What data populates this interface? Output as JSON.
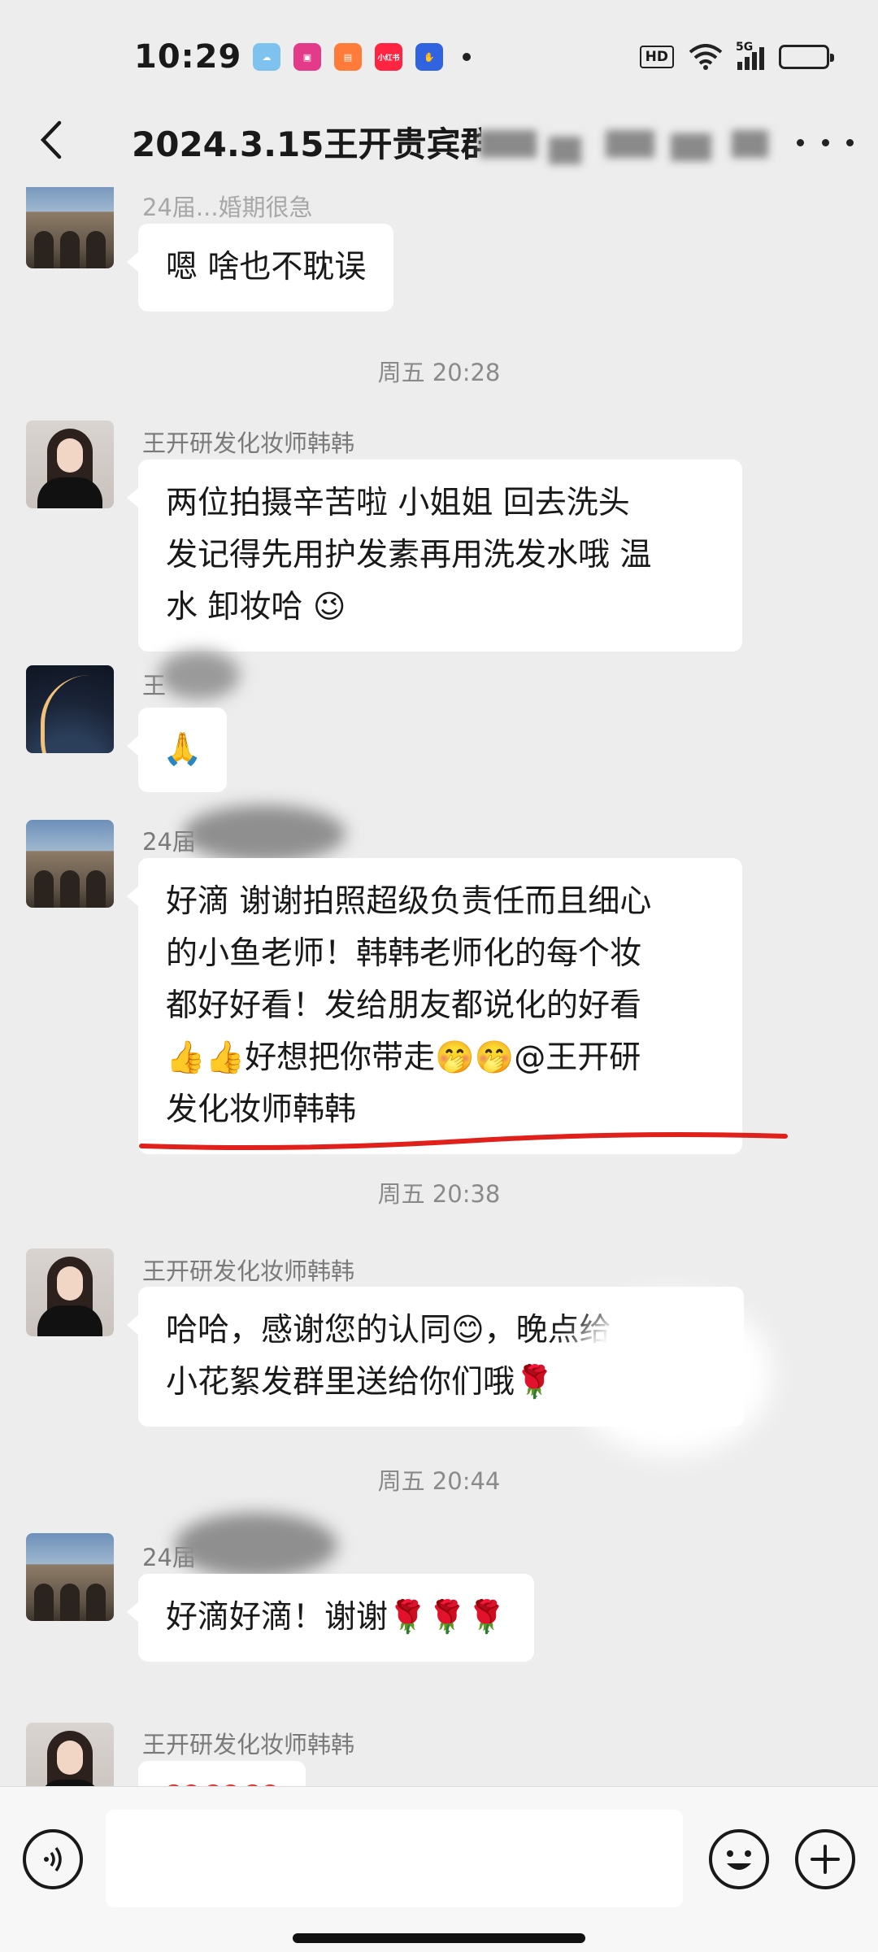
{
  "status_bar": {
    "time": "10:29",
    "app_icons": [
      {
        "icon": "weather-icon",
        "color": "#7ec3ef"
      },
      {
        "icon": "app-icon",
        "color": "#e33b8a"
      },
      {
        "icon": "book-icon",
        "color": "#ff7b3a"
      },
      {
        "icon": "xiaohongshu-icon",
        "label": "小红书",
        "color": "#ff2442"
      },
      {
        "icon": "baidu-icon",
        "color": "#2f63e0"
      }
    ],
    "hd_label": "HD",
    "network_label": "5G"
  },
  "nav": {
    "title": "2024.3.15王开贵宾群"
  },
  "messages": [
    {
      "type": "incoming",
      "sender": "24届...婚期很急",
      "avatar": "avatar-building",
      "text": "嗯 啥也不耽误"
    },
    {
      "type": "time",
      "text": "周五 20:28"
    },
    {
      "type": "incoming",
      "sender": "王开研发化妆师韩韩",
      "avatar": "avatar-portrait",
      "text": "两位拍摄辛苦啦 小姐姐 回去洗头\n发记得先用护发素再用洗发水哦 温\n水 卸妆哈 😉"
    },
    {
      "type": "incoming",
      "sender": "王",
      "avatar": "avatar-sky",
      "text": "🙏"
    },
    {
      "type": "incoming",
      "sender": "24届",
      "avatar": "avatar-building",
      "text": "好滴 谢谢拍照超级负责任而且细心\n的小鱼老师！韩韩老师化的每个妆\n都好好看！发给朋友都说化的好看\n👍👍好想把你带走🤭🤭@王开研\n发化妆师韩韩"
    },
    {
      "type": "time",
      "text": "周五 20:38"
    },
    {
      "type": "incoming",
      "sender": "王开研发化妆师韩韩",
      "avatar": "avatar-portrait",
      "text": "哈哈，感谢您的认同😊，晚点给\n小花絮发群里送给你们哦🌹"
    },
    {
      "type": "time",
      "text": "周五 20:44"
    },
    {
      "type": "incoming",
      "sender": "24届",
      "avatar": "avatar-building",
      "text": "好滴好滴！谢谢🌹🌹🌹"
    },
    {
      "type": "incoming",
      "sender": "王开研发化妆师韩韩",
      "avatar": "avatar-portrait",
      "text": "❤️❤️❤️"
    }
  ],
  "input_bar": {
    "placeholder": "",
    "voice_icon": "voice-icon",
    "emoji_icon": "emoji-icon",
    "plus_icon": "plus-icon"
  },
  "colors": {
    "background": "#ededed",
    "bubble": "#ffffff",
    "annotation": "#e0201b"
  }
}
